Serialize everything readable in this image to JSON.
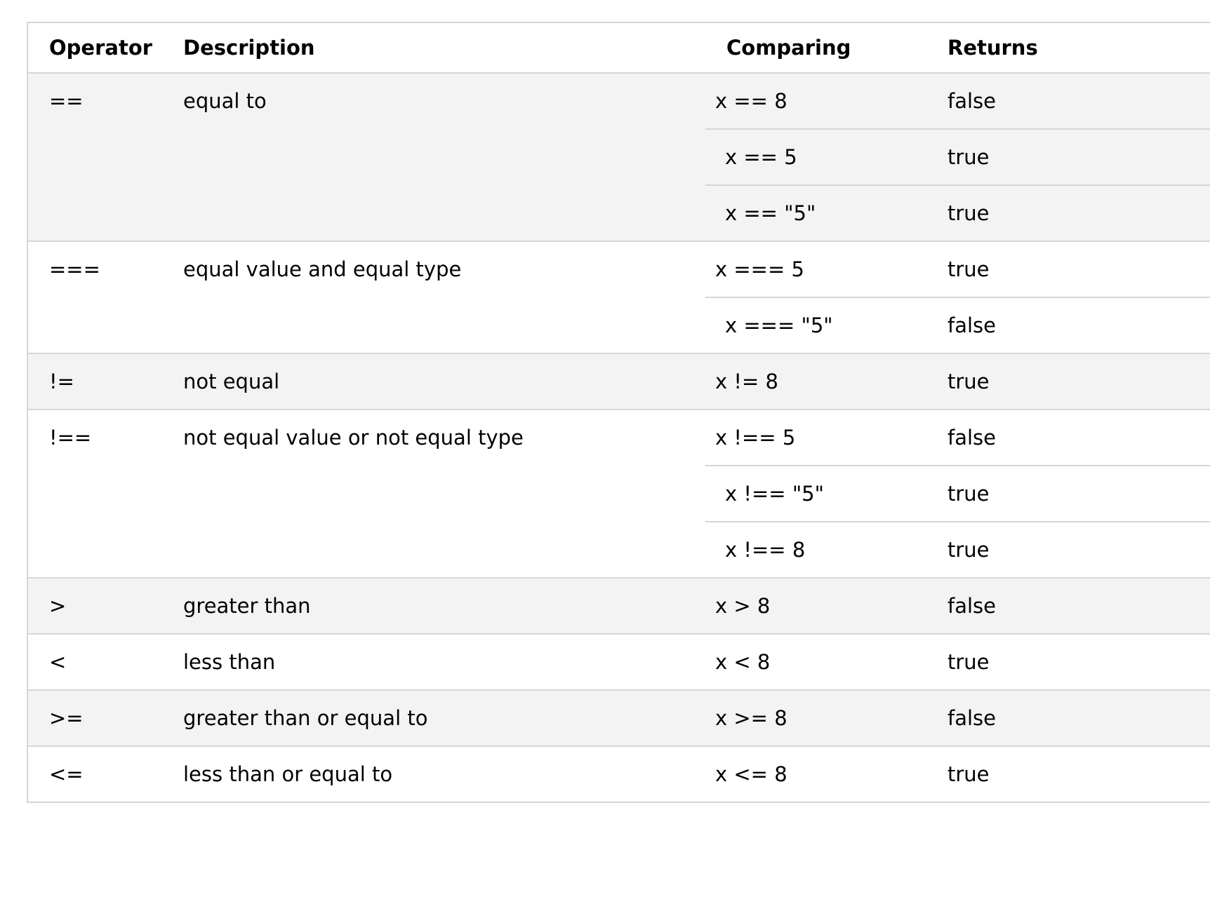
{
  "table": {
    "headers": [
      "Operator",
      "Description",
      "Comparing",
      "Returns"
    ],
    "groups": [
      {
        "operator": "==",
        "description": "equal to",
        "examples": [
          {
            "comparing": "x == 8",
            "returns": "false"
          },
          {
            "comparing": "x == 5",
            "returns": "true"
          },
          {
            "comparing": "x == \"5\"",
            "returns": "true"
          }
        ]
      },
      {
        "operator": "===",
        "description": "equal value and equal type",
        "examples": [
          {
            "comparing": "x === 5",
            "returns": "true"
          },
          {
            "comparing": "x === \"5\"",
            "returns": "false"
          }
        ]
      },
      {
        "operator": "!=",
        "description": "not equal",
        "examples": [
          {
            "comparing": "x != 8",
            "returns": "true"
          }
        ]
      },
      {
        "operator": "!==",
        "description": "not equal value or not equal type",
        "examples": [
          {
            "comparing": "x !== 5",
            "returns": "false"
          },
          {
            "comparing": "x !== \"5\"",
            "returns": "true"
          },
          {
            "comparing": "x !== 8",
            "returns": "true"
          }
        ]
      },
      {
        "operator": ">",
        "description": "greater than",
        "examples": [
          {
            "comparing": "x > 8",
            "returns": "false"
          }
        ]
      },
      {
        "operator": "<",
        "description": "less than",
        "examples": [
          {
            "comparing": "x < 8",
            "returns": "true"
          }
        ]
      },
      {
        "operator": ">=",
        "description": "greater than or equal to",
        "examples": [
          {
            "comparing": "x >= 8",
            "returns": "false"
          }
        ]
      },
      {
        "operator": "<=",
        "description": "less than or equal to",
        "examples": [
          {
            "comparing": "x <= 8",
            "returns": "true"
          }
        ]
      }
    ]
  },
  "colors": {
    "shaded_row": "#f3f3f3",
    "plain_row": "#ffffff",
    "border": "#d6d6d6",
    "text": "#000000"
  }
}
